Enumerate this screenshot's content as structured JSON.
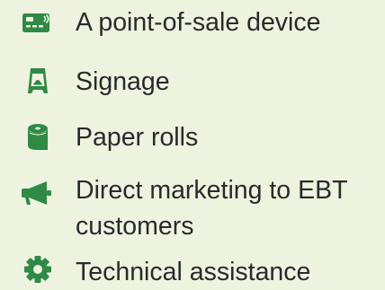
{
  "colors": {
    "background": "#eef3e0",
    "icon": "#2e8a45",
    "text": "#2a2a2a"
  },
  "items": [
    {
      "icon": "card-reader-icon",
      "label": "A point-of-sale device"
    },
    {
      "icon": "sandwich-board-sign-icon",
      "label": "Signage"
    },
    {
      "icon": "paper-roll-icon",
      "label": "Paper rolls"
    },
    {
      "icon": "megaphone-icon",
      "label": "Direct marketing to EBT customers"
    },
    {
      "icon": "gear-icon",
      "label": "Technical assistance"
    }
  ]
}
